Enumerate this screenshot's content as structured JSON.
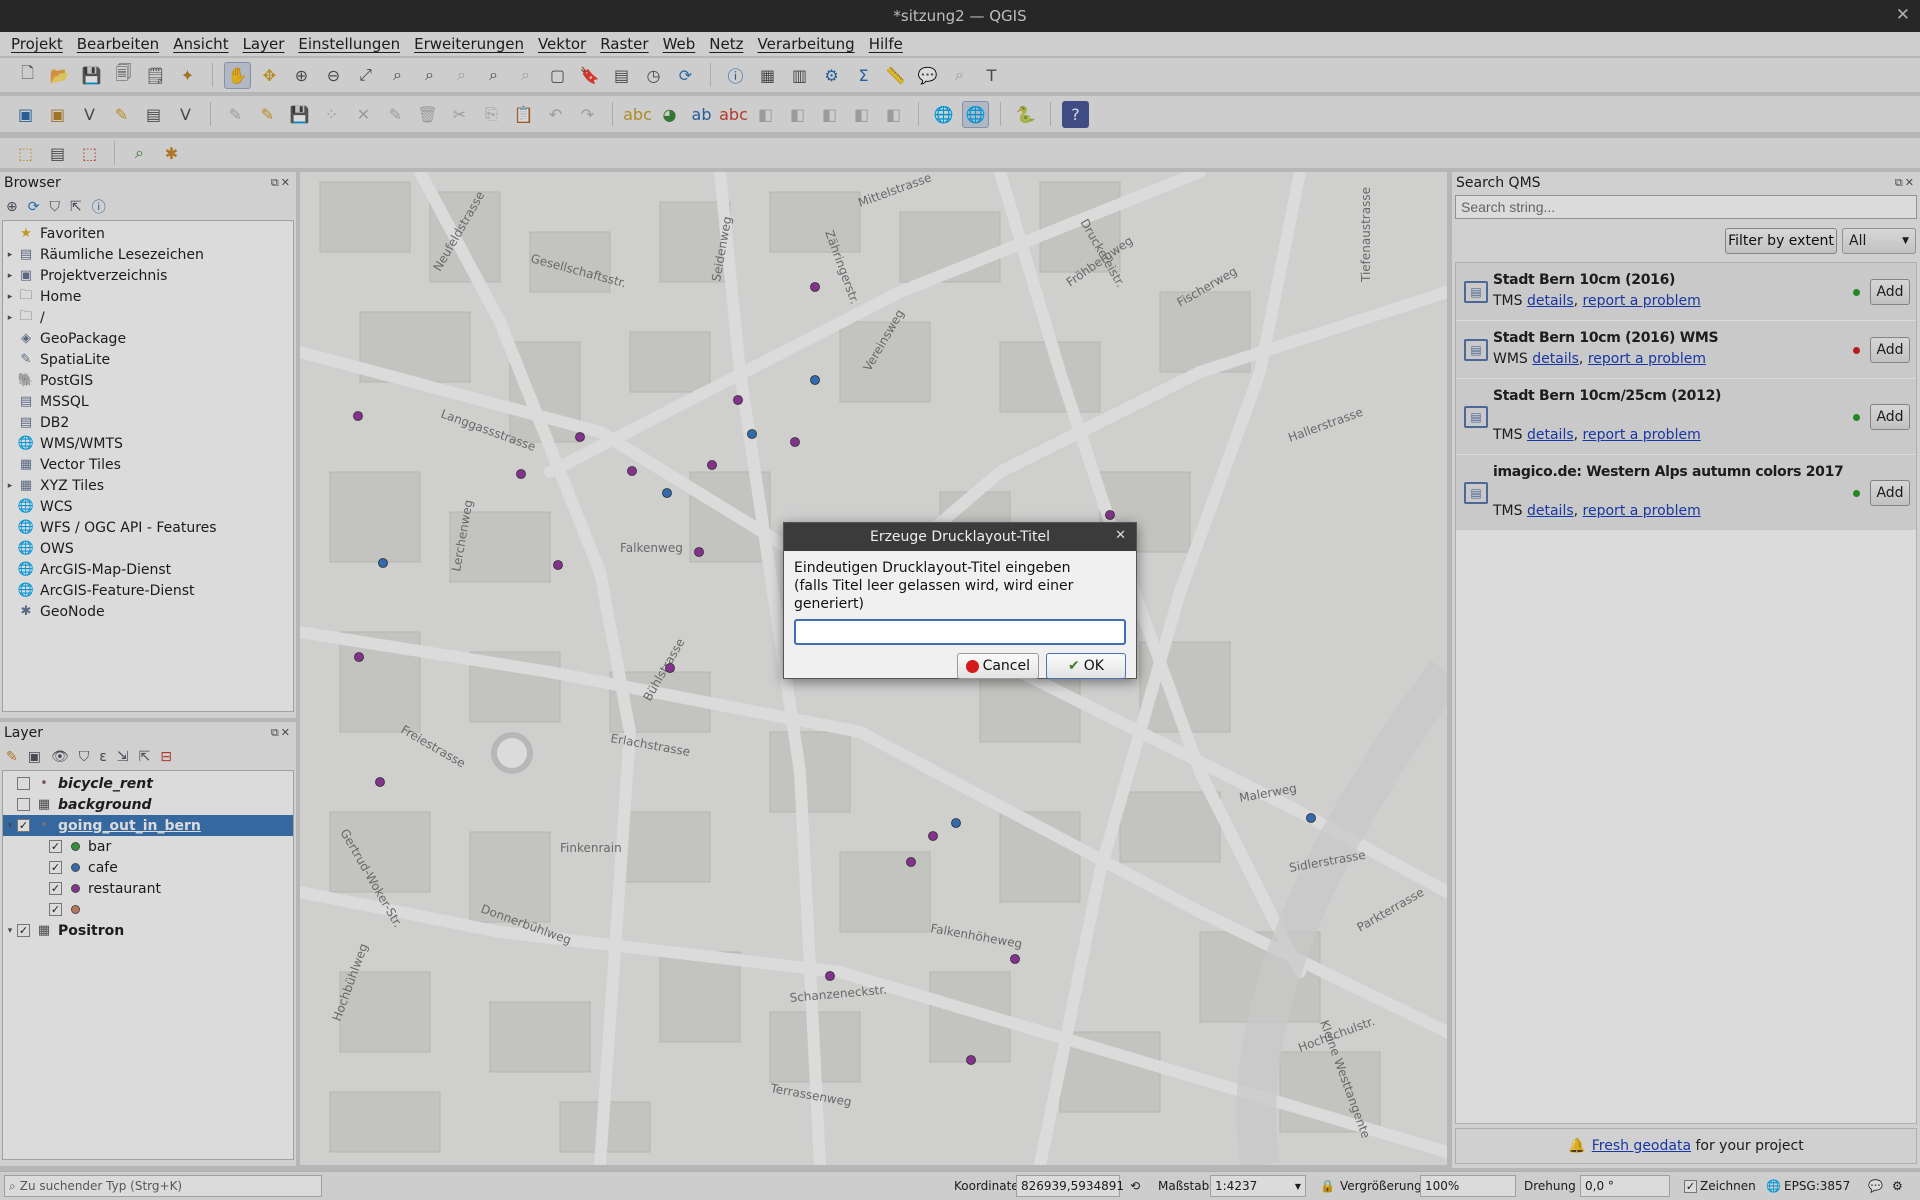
{
  "window": {
    "title": "*sitzung2 — QGIS"
  },
  "menu": [
    "Projekt",
    "Bearbeiten",
    "Ansicht",
    "Layer",
    "Einstellungen",
    "Erweiterungen",
    "Vektor",
    "Raster",
    "Web",
    "Netz",
    "Verarbeitung",
    "Hilfe"
  ],
  "browser": {
    "title": "Browser",
    "items": [
      {
        "label": "Favoriten",
        "icon": "star-icon",
        "expand": false
      },
      {
        "label": "Räumliche Lesezeichen",
        "icon": "bookmark-icon",
        "expand": true
      },
      {
        "label": "Projektverzeichnis",
        "icon": "project-folder-icon",
        "expand": true
      },
      {
        "label": "Home",
        "icon": "folder-icon",
        "expand": true
      },
      {
        "label": "/",
        "icon": "folder-icon",
        "expand": true
      },
      {
        "label": "GeoPackage",
        "icon": "geopackage-icon",
        "expand": false
      },
      {
        "label": "SpatiaLite",
        "icon": "spatialite-icon",
        "expand": false
      },
      {
        "label": "PostGIS",
        "icon": "postgis-icon",
        "expand": false
      },
      {
        "label": "MSSQL",
        "icon": "mssql-icon",
        "expand": false
      },
      {
        "label": "DB2",
        "icon": "db2-icon",
        "expand": false
      },
      {
        "label": "WMS/WMTS",
        "icon": "wms-icon",
        "expand": false
      },
      {
        "label": "Vector Tiles",
        "icon": "vector-tiles-icon",
        "expand": false
      },
      {
        "label": "XYZ Tiles",
        "icon": "xyz-tiles-icon",
        "expand": true
      },
      {
        "label": "WCS",
        "icon": "wcs-icon",
        "expand": false
      },
      {
        "label": "WFS / OGC API - Features",
        "icon": "wfs-icon",
        "expand": false
      },
      {
        "label": "OWS",
        "icon": "ows-icon",
        "expand": false
      },
      {
        "label": "ArcGIS-Map-Dienst",
        "icon": "arcgis-map-icon",
        "expand": false
      },
      {
        "label": "ArcGIS-Feature-Dienst",
        "icon": "arcgis-feature-icon",
        "expand": false
      },
      {
        "label": "GeoNode",
        "icon": "geonode-icon",
        "expand": false
      }
    ]
  },
  "layers": {
    "title": "Layer",
    "items": [
      {
        "label": "bicycle_rent",
        "level": 0,
        "checked": false,
        "italic": true,
        "bold": true,
        "expand": "",
        "icon": "point-icon",
        "color": "#8a6a6a",
        "selected": false
      },
      {
        "label": "background",
        "level": 0,
        "checked": false,
        "italic": true,
        "bold": true,
        "expand": "",
        "icon": "raster-icon",
        "color": "#555",
        "selected": false
      },
      {
        "label": "going_out_in_bern",
        "level": 0,
        "checked": true,
        "italic": false,
        "bold": true,
        "expand": "▾",
        "icon": "point-icon",
        "color": "#888",
        "selected": true
      },
      {
        "label": "bar",
        "level": 1,
        "checked": true,
        "italic": false,
        "bold": false,
        "expand": "",
        "icon": "dot",
        "color": "#3aa844",
        "selected": false
      },
      {
        "label": "cafe",
        "level": 1,
        "checked": true,
        "italic": false,
        "bold": false,
        "expand": "",
        "icon": "dot",
        "color": "#3b7cc9",
        "selected": false
      },
      {
        "label": "restaurant",
        "level": 1,
        "checked": true,
        "italic": false,
        "bold": false,
        "expand": "",
        "icon": "dot",
        "color": "#9b3aa6",
        "selected": false
      },
      {
        "label": "",
        "level": 1,
        "checked": true,
        "italic": false,
        "bold": false,
        "expand": "",
        "icon": "dot",
        "color": "#d98a6a",
        "selected": false
      },
      {
        "label": "Positron",
        "level": 0,
        "checked": true,
        "italic": false,
        "bold": true,
        "expand": "▾",
        "icon": "raster-icon",
        "color": "#555",
        "selected": false
      }
    ]
  },
  "dialog": {
    "title": "Erzeuge Drucklayout-Titel",
    "message_line1": "Eindeutigen Drucklayout-Titel eingeben",
    "message_line2": "(falls Titel leer gelassen wird, wird einer generiert)",
    "input_value": "",
    "cancel": "Cancel",
    "ok": "OK"
  },
  "qms": {
    "title": "Search QMS",
    "search_placeholder": "Search string...",
    "filter_button": "Filter by extent",
    "filter_value": "All",
    "results": [
      {
        "title": "Stadt Bern 10cm (2016)",
        "type": "TMS",
        "details": "details",
        "report": "report a problem",
        "status": "#2a9d2a",
        "add": "Add"
      },
      {
        "title": "Stadt Bern 10cm (2016) WMS",
        "type": "WMS",
        "details": "details",
        "report": "report a problem",
        "status": "#d62020",
        "add": "Add"
      },
      {
        "title": "Stadt Bern 10cm/25cm (2012)",
        "type": "TMS",
        "details": "details",
        "report": "report a problem",
        "status": "#2a9d2a",
        "add": "Add"
      },
      {
        "title": "imagico.de: Western Alps autumn colors 2017",
        "type": "TMS",
        "details": "details",
        "report": "report a problem",
        "status": "#2a9d2a",
        "add": "Add"
      }
    ],
    "footer_link": "Fresh geodata",
    "footer_text": " for your project"
  },
  "status": {
    "search_placeholder": "Zu suchender Typ (Strg+K)",
    "coord_label": "Koordinate",
    "coord_value": "826939,5934891",
    "scale_label": "Maßstab",
    "scale_value": "1:4237",
    "magnifier_label": "Vergrößerung",
    "magnifier_value": "100%",
    "rotation_label": "Drehung",
    "rotation_value": "0,0 °",
    "render_label": "Zeichnen",
    "crs": "EPSG:3857"
  },
  "map": {
    "street_labels": [
      {
        "t": "Zähringerstr.",
        "r": 70
      },
      {
        "t": "Mittelstrasse",
        "r": -20
      },
      {
        "t": "Druckereistr.",
        "r": 60
      },
      {
        "t": "Gesellschaftsstr.",
        "r": 15
      },
      {
        "t": "Neufeldstrasse",
        "r": -60
      },
      {
        "t": "Seidenweg",
        "r": -80
      },
      {
        "t": "Vereinsweg",
        "r": -60
      },
      {
        "t": "Fröhbergweg",
        "r": -35
      },
      {
        "t": "Fischerweg",
        "r": -30
      },
      {
        "t": "Langgassstrasse",
        "r": 20
      },
      {
        "t": "Lerchenweg",
        "r": -80
      },
      {
        "t": "Falkenweg",
        "r": 0
      },
      {
        "t": "Mittelstrasse",
        "r": 80
      },
      {
        "t": "Erlachstrasse",
        "r": 10
      },
      {
        "t": "Donnerbühlweg",
        "r": 20
      },
      {
        "t": "Falkenhöheweg",
        "r": 10
      },
      {
        "t": "Schanzeneckstr.",
        "r": -5
      },
      {
        "t": "Terrassenweg",
        "r": 10
      },
      {
        "t": "Kleine Westtangente",
        "r": 70
      },
      {
        "t": "Tiefenaustrasse",
        "r": -90
      },
      {
        "t": "Sidlerstrasse",
        "r": -10
      },
      {
        "t": "Hallerstrasse",
        "r": -20
      },
      {
        "t": "Finkenrain",
        "r": 0
      },
      {
        "t": "Bühlstrasse",
        "r": -60
      },
      {
        "t": "Hochbühlweg",
        "r": -70
      },
      {
        "t": "Gertrud-Woker-Str.",
        "r": 60
      },
      {
        "t": "Freiestrasse",
        "r": 30
      },
      {
        "t": "Malerweg",
        "r": -10
      },
      {
        "t": "Hochschulstr.",
        "r": -20
      },
      {
        "t": "Parkterrasse",
        "r": -30
      }
    ],
    "points": [
      {
        "c": "#9b3aa6"
      },
      {
        "c": "#3b7cc9"
      },
      {
        "c": "#9b3aa6"
      },
      {
        "c": "#3b7cc9"
      },
      {
        "c": "#9b3aa6"
      },
      {
        "c": "#9b3aa6"
      },
      {
        "c": "#9b3aa6"
      },
      {
        "c": "#9b3aa6"
      },
      {
        "c": "#9b3aa6"
      },
      {
        "c": "#9b3aa6"
      },
      {
        "c": "#3b7cc9"
      },
      {
        "c": "#9b3aa6"
      },
      {
        "c": "#3b7cc9"
      },
      {
        "c": "#9b3aa6"
      },
      {
        "c": "#9b3aa6"
      },
      {
        "c": "#9b3aa6"
      },
      {
        "c": "#9b3aa6"
      },
      {
        "c": "#9b3aa6"
      },
      {
        "c": "#3b7cc9"
      },
      {
        "c": "#9b3aa6"
      },
      {
        "c": "#9b3aa6"
      },
      {
        "c": "#9b3aa6"
      },
      {
        "c": "#9b3aa6"
      },
      {
        "c": "#9b3aa6"
      },
      {
        "c": "#3b7cc9"
      }
    ]
  }
}
